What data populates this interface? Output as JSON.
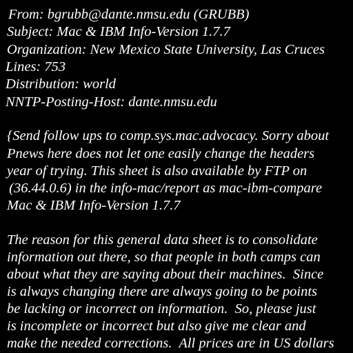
{
  "theme": {
    "background": "#000000",
    "text_color": "#ffffff"
  },
  "article": {
    "headers": [
      "From: bgrubb@dante.nmsu.edu (GRUBB)",
      "Subject: Mac & IBM Info-Version 1.7.7",
      "Organization: New Mexico State University, Las Cruces",
      "Lines: 753",
      "Distribution: world",
      "NNTP-Posting-Host: dante.nmsu.edu"
    ],
    "intro_lines": [
      "{Send follow ups to comp.sys.mac.advocacy. Sorry about",
      "Pnews here does not let one easily change the headers",
      "year of trying. This sheet is also available by FTP on",
      " (36.44.0.6) in the info-mac/report as mac-ibm-compare",
      "Mac & IBM Info-Version 1.7.7"
    ],
    "body_lines": [
      "The reason for this general data sheet is to consolidate",
      "information out there, so that people in both camps can",
      "about what they are saying about their machines.  Since",
      "is always changing there are always going to be points",
      "be lacking or incorrect on information.  So, please just",
      "is incomplete or incorrect but also give me clear and",
      "make the needed corrections.  All prices are in US dollars"
    ]
  }
}
